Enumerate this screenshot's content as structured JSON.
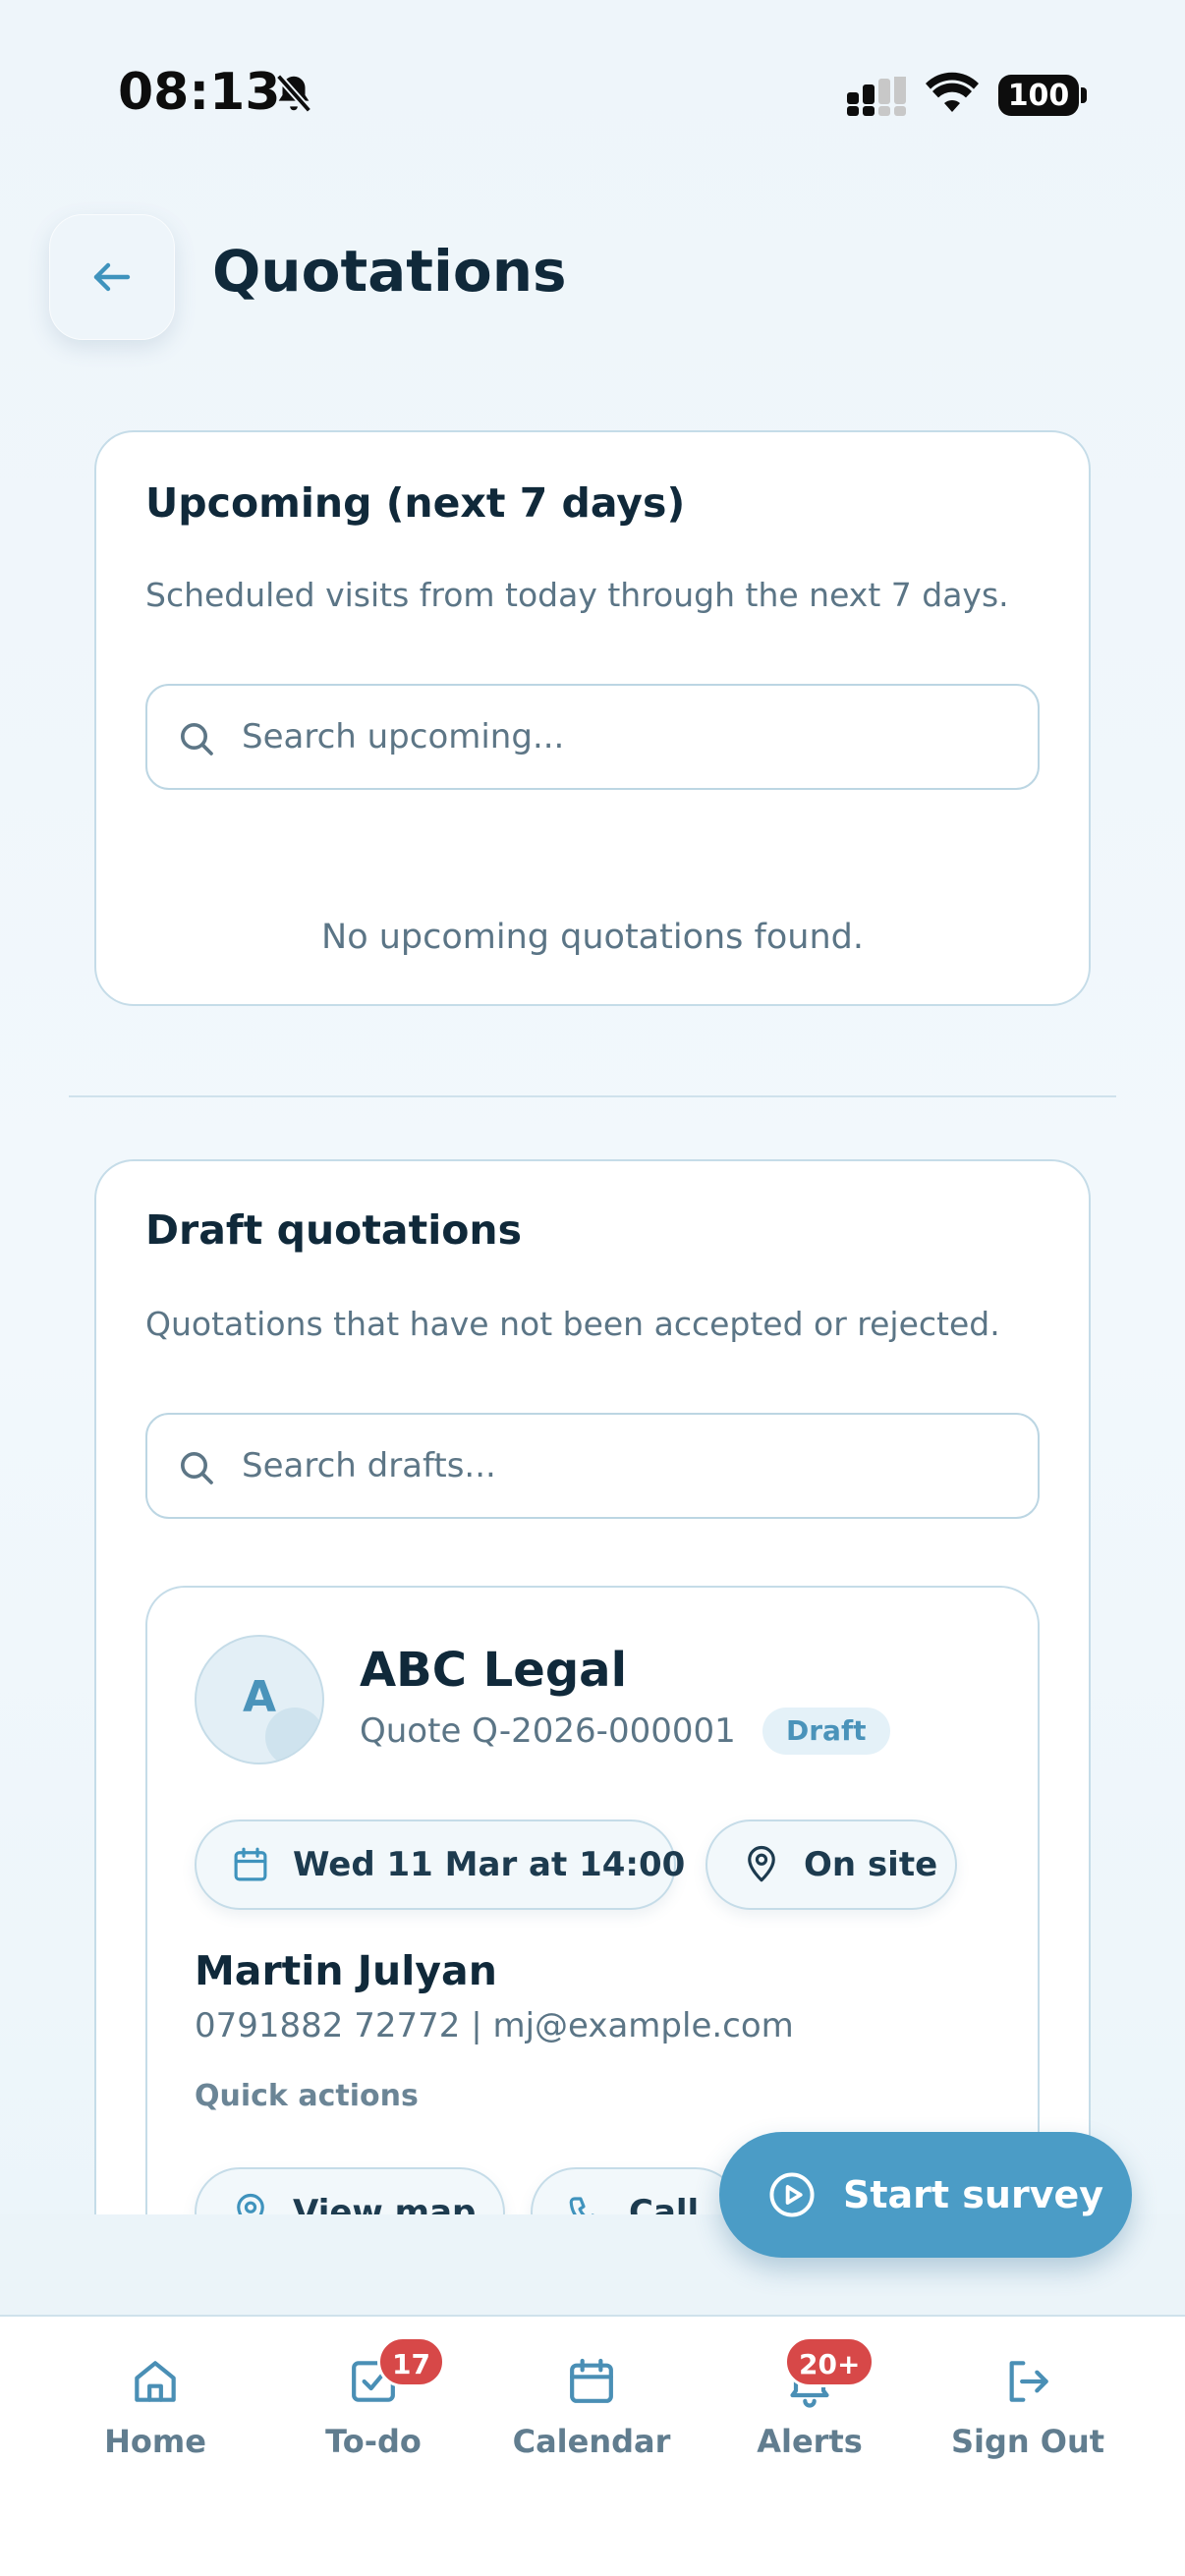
{
  "status_bar": {
    "time": "08:13",
    "battery": "100"
  },
  "header": {
    "title": "Quotations",
    "back_icon": "arrow-left-icon"
  },
  "upcoming": {
    "title": "Upcoming (next 7 days)",
    "description": "Scheduled visits from today through the next 7 days.",
    "search_placeholder": "Search upcoming...",
    "empty_message": "No upcoming quotations found."
  },
  "drafts": {
    "title": "Draft quotations",
    "description": "Quotations that have not been accepted or rejected.",
    "search_placeholder": "Search drafts...",
    "items": [
      {
        "avatar_letter": "A",
        "company": "ABC Legal",
        "quote_ref": "Quote Q-2026-000001",
        "status": "Draft",
        "date": "Wed 11 Mar at 14:00",
        "location": "On site",
        "contact_name": "Martin Julyan",
        "contact_details": "0791882 72772 | mj@example.com",
        "quick_actions_label": "Quick actions",
        "actions": {
          "view_map": "View map",
          "call": "Call"
        }
      }
    ]
  },
  "fab": {
    "label": "Start survey"
  },
  "nav": {
    "items": [
      {
        "label": "Home",
        "icon": "home-icon"
      },
      {
        "label": "To-do",
        "icon": "todo-icon",
        "badge": "17"
      },
      {
        "label": "Calendar",
        "icon": "calendar-icon"
      },
      {
        "label": "Alerts",
        "icon": "bell-icon",
        "badge": "20+"
      },
      {
        "label": "Sign Out",
        "icon": "sign-out-icon"
      }
    ]
  },
  "colors": {
    "accent": "#4b9cc6",
    "badge": "#d74848",
    "title_text": "#10293a",
    "muted_text": "#5b7586"
  }
}
